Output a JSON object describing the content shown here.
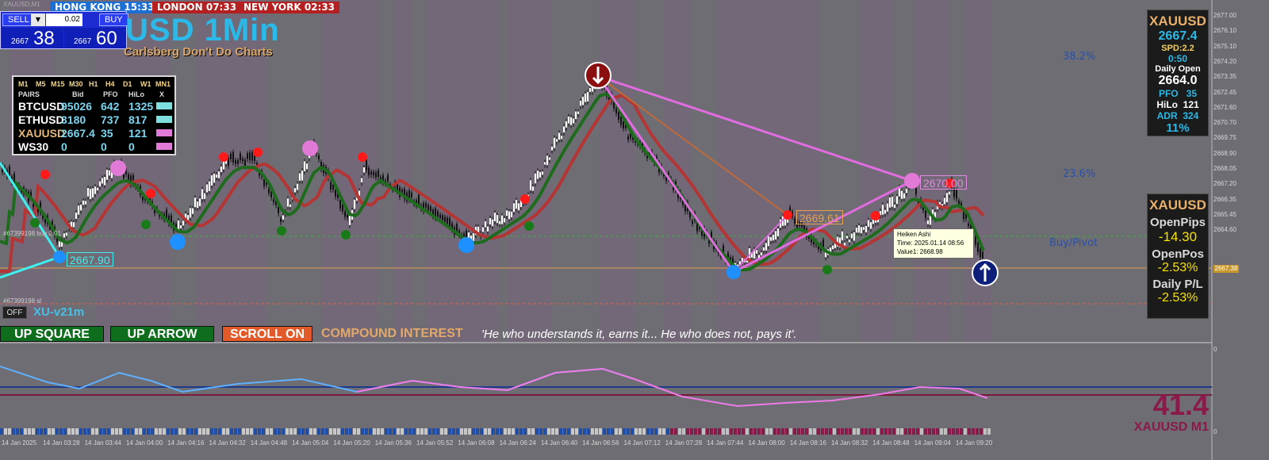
{
  "window": {
    "corner_label": "XAUUSD,M1"
  },
  "clocks": [
    {
      "label": "HONG KONG 15:33",
      "color": "#1c6fd4"
    },
    {
      "label": "LONDON  07:33",
      "color": "#b51f1f"
    },
    {
      "label": "NEW YORK  02:33",
      "color": "#b51f1f"
    }
  ],
  "trade_panel": {
    "sell_label": "SELL",
    "buy_label": "BUY",
    "lot_value": "0.02",
    "sell_small": "2667",
    "sell_big": "38",
    "buy_small": "2667",
    "buy_big": "60"
  },
  "chart_title": "USD 1Min",
  "chart_subtitle": "Carlsberg Don't Do Charts",
  "watchlist": {
    "timeframes": [
      "M1",
      "M5",
      "M15",
      "M30",
      "H1",
      "H4",
      "D1",
      "W1",
      "MN1"
    ],
    "headers": [
      "PAIRS",
      "Bid",
      "PFO",
      "HiLo",
      "X"
    ],
    "rows": [
      {
        "pair": "BTCUSD",
        "bid": "95026",
        "pfo": "642",
        "hilo": "1325",
        "color": "#7fdede",
        "pair_color": "#ffffff"
      },
      {
        "pair": "ETHUSD",
        "bid": "3180",
        "pfo": "737",
        "hilo": "817",
        "color": "#7fdede",
        "pair_color": "#ffffff"
      },
      {
        "pair": "XAUUSD",
        "bid": "2667.4",
        "pfo": "35",
        "hilo": "121",
        "color": "#e07ad6",
        "pair_color": "#e3b77a"
      },
      {
        "pair": "WS30",
        "bid": "0",
        "pfo": "0",
        "hilo": "0",
        "color": "#e07ad6",
        "pair_color": "#ffffff"
      }
    ]
  },
  "fib_levels": {
    "f382": "38.2%",
    "f236": "23.6%"
  },
  "pivot_label": "Buy/Pivot",
  "price_tags": {
    "low_left": "2667.90",
    "mid": "2669.61",
    "right": "2670.00"
  },
  "tooltip": {
    "line1": "Heiken Ashi",
    "line2": "Time: 2025.01.14 08:56",
    "line3": "Value1: 2668.98"
  },
  "order_labels": {
    "buy_line": "#67399198 buy 0.01",
    "sl_line": "#67399198 sl"
  },
  "price_badge": "2667.38",
  "info_panel": {
    "symbol": "XAUUSD",
    "price": "2667.4",
    "spread": "SPD:2.2",
    "timer": "0:50",
    "daily_open_label": "Daily Open",
    "daily_open": "2664.0",
    "pfo_label": "PFO",
    "pfo": "35",
    "hilo_label": "HiLo",
    "hilo": "121",
    "adr_label": "ADR",
    "adr": "324",
    "adr_pct": "11%"
  },
  "pnl_panel": {
    "symbol": "XAUUSD",
    "open_pips_label": "OpenPips",
    "open_pips": "-14.30",
    "open_pos_label": "OpenPos",
    "open_pos": "-2.53%",
    "daily_pl_label": "Daily P/L",
    "daily_pl": "-2.53%"
  },
  "bottom_bar": {
    "off_label": "OFF",
    "version": "XU-v21m",
    "up_square": "UP SQUARE",
    "up_arrow": "UP ARROW",
    "scroll": "SCROLL ON",
    "compound": "COMPOUND INTEREST",
    "quote": "'He who understands it, earns it... He who does not, pays it'."
  },
  "indicator": {
    "value": "41.4",
    "symbol": "XAUUSD M1",
    "scale_top": "0",
    "scale_bottom": "0"
  },
  "price_axis": [
    "2677.00",
    "2676.10",
    "2675.10",
    "2674.20",
    "2673.35",
    "2672.45",
    "2671.60",
    "2670.70",
    "2669.75",
    "2668.90",
    "2668.05",
    "2667.20",
    "2666.35",
    "2665.45",
    "2664.60"
  ],
  "time_axis": [
    "14 Jan 2025",
    "14 Jan 03:28",
    "14 Jan 03:44",
    "14 Jan 04:00",
    "14 Jan 04:16",
    "14 Jan 04:32",
    "14 Jan 04:48",
    "14 Jan 05:04",
    "14 Jan 05:20",
    "14 Jan 05:36",
    "14 Jan 05:52",
    "14 Jan 06:08",
    "14 Jan 06:24",
    "14 Jan 06:40",
    "14 Jan 06:56",
    "14 Jan 07:12",
    "14 Jan 07:28",
    "14 Jan 07:44",
    "14 Jan 08:00",
    "14 Jan 08:16",
    "14 Jan 08:32",
    "14 Jan 08:48",
    "14 Jan 09:04",
    "14 Jan 09:20"
  ],
  "colors": {
    "bg": "#6d6d73",
    "fast_ma": "#1e6b1e",
    "slow_ma": "#b53535",
    "zigzag": "#e06ce0",
    "accent_blue": "#1e90ff"
  }
}
